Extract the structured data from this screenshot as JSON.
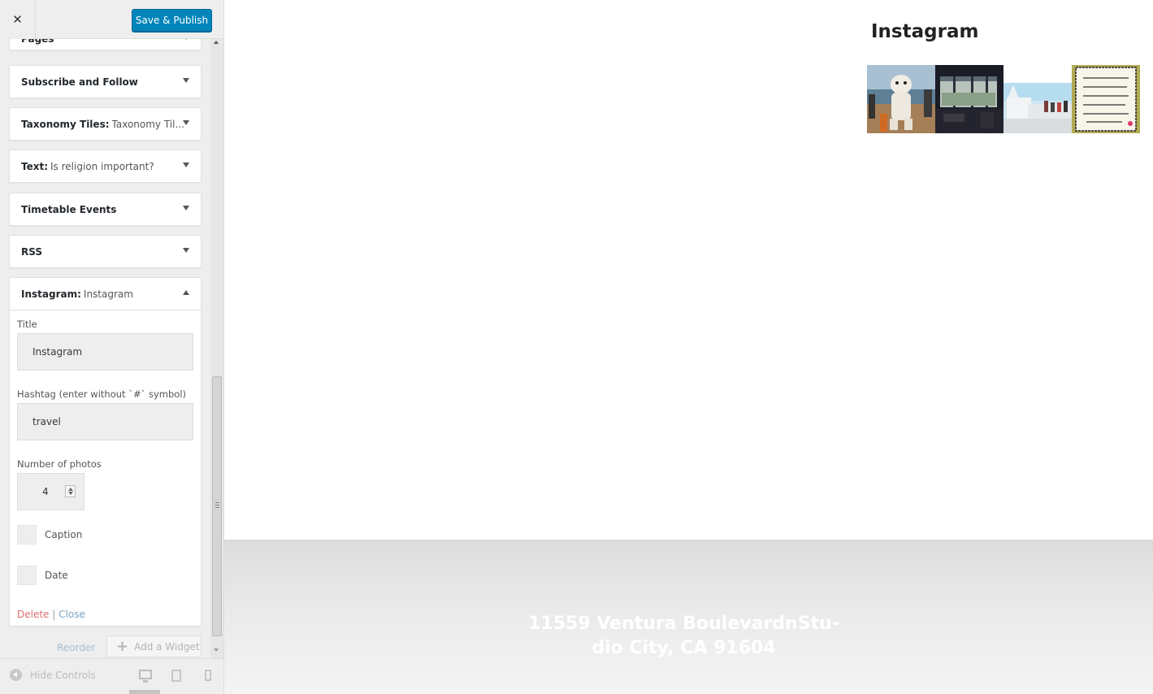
{
  "header": {
    "close_icon": "close-icon",
    "publish_label": "Save & Publish",
    "publish_color": "#0085ba"
  },
  "widgets": {
    "pages": {
      "title": "Pages",
      "sub": ""
    },
    "subscribe": {
      "title": "Subscribe and Follow",
      "sub": ""
    },
    "taxonomy": {
      "title": "Taxonomy Tiles:",
      "sub": "Taxonomy Til..."
    },
    "text": {
      "title": "Text:",
      "sub": "Is religion important?"
    },
    "timetable": {
      "title": "Timetable Events",
      "sub": ""
    },
    "rss": {
      "title": "RSS",
      "sub": ""
    },
    "instagram": {
      "title": "Instagram:",
      "sub": "Instagram"
    }
  },
  "instagram_form": {
    "title_label": "Title",
    "title_value": "Instagram",
    "hashtag_label": "Hashtag (enter without `#` symbol)",
    "hashtag_value": "travel",
    "photos_label": "Number of photos",
    "photos_value": "4",
    "caption_label": "Caption",
    "date_label": "Date",
    "delete_label": "Delete",
    "separator": "|",
    "close_label": "Close"
  },
  "footer_actions": {
    "reorder_label": "Reorder",
    "add_widget_label": "Add a Widget",
    "add_icon": "plus-icon"
  },
  "bottom_bar": {
    "hide_controls_label": "Hide Controls",
    "devices": [
      "desktop-icon",
      "tablet-icon",
      "mobile-icon"
    ]
  },
  "preview": {
    "instagram_heading": "Instagram",
    "photos": [
      "instagram-photo-1",
      "instagram-photo-2",
      "instagram-photo-3",
      "instagram-photo-4"
    ],
    "footer_address_line1": "11559 Ventura BoulevardnStu-",
    "footer_address_line2": "dio City, CA 91604"
  }
}
